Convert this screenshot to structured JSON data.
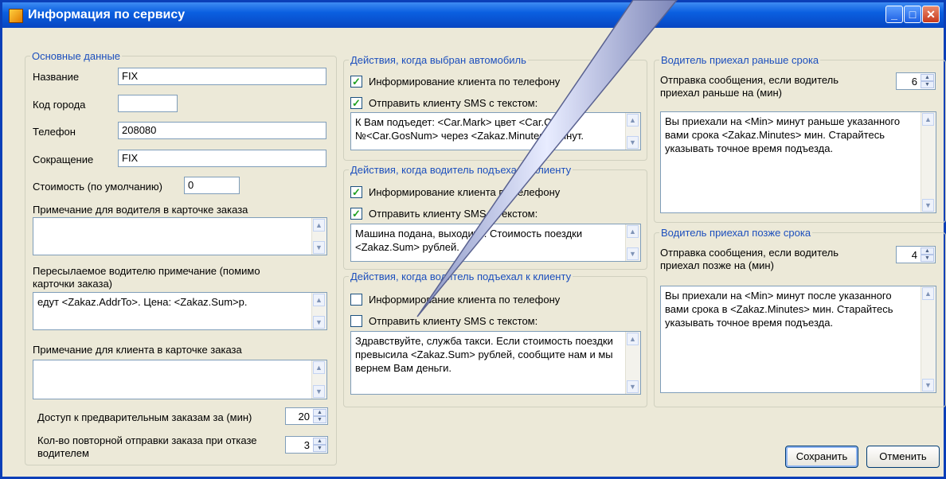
{
  "window": {
    "title": "Информация по сервису"
  },
  "basic": {
    "legend": "Основные данные",
    "name_label": "Название",
    "name_value": "FIX",
    "city_label": "Код города",
    "city_value": "",
    "phone_label": "Телефон",
    "phone_value": "208080",
    "abbr_label": "Сокращение",
    "abbr_value": "FIX",
    "cost_label": "Стоимость (по умолчанию)",
    "cost_value": "0",
    "driver_note_label": "Примечание для водителя в карточке заказа",
    "driver_note_value": "",
    "forward_note_label": "Пересылаемое водителю примечание (помимо карточки заказа)",
    "forward_note_value": "едут <Zakaz.AddrTo>. Цена: <Zakaz.Sum>р.",
    "client_note_label": "Примечание для клиента в карточке заказа",
    "client_note_value": "",
    "preorder_label": "Доступ к предварительным заказам за (мин)",
    "preorder_value": "20",
    "resend_label": "Кол-во повторной отправки заказа при отказе водителем",
    "resend_value": "3"
  },
  "car_selected": {
    "legend": "Действия, когда выбран автомобиль",
    "inform_label": "Информирование клиента по телефону",
    "inform_checked": true,
    "sms_label": "Отправить клиенту SMS с текстом:",
    "sms_checked": true,
    "sms_text": "К Вам подъедет: <Car.Mark> цвет <Car.Color> №<Car.GosNum> через <Zakaz.Minutes> минут."
  },
  "driver_arrived": {
    "legend": "Действия, когда водитель подъехал к клиенту",
    "inform_label": "Информирование клиента по телефону",
    "inform_checked": true,
    "sms_label": "Отправить клиенту SMS с текстом:",
    "sms_checked": true,
    "sms_text": "Машина подана, выходите. Стоимость поездки <Zakaz.Sum> рублей."
  },
  "driver_arrived2": {
    "legend": "Действия, когда водитель подъехал к клиенту",
    "inform_label": "Информирование клиента по телефону",
    "inform_checked": false,
    "sms_label": "Отправить клиенту SMS с текстом:",
    "sms_checked": false,
    "sms_text": "Здравствуйте, служба такси. Если стоимость поездки превысила <Zakaz.Sum> рублей, сообщите нам и мы вернем Вам деньги."
  },
  "early": {
    "legend": "Водитель приехал раньше срока",
    "send_label": "Отправка сообщения, если водитель приехал раньше на  (мин)",
    "send_value": "6",
    "text": "Вы приехали на <Min> минут раньше указанного вами срока <Zakaz.Minutes> мин. Старайтесь указывать точное время подъезда."
  },
  "late": {
    "legend": "Водитель приехал позже срока",
    "send_label": "Отправка сообщения, если водитель приехал позже на  (мин)",
    "send_value": "4",
    "text": "Вы приехали на <Min> минут после указанного вами срока в <Zakaz.Minutes> мин. Старайтесь указывать точное время подъезда."
  },
  "buttons": {
    "save": "Сохранить",
    "cancel": "Отменить"
  },
  "colors": {
    "legend": "#1c4fbd",
    "titlebar": "#0a5fe0",
    "check": "#21a121",
    "backdrop": "#f4c21c"
  }
}
